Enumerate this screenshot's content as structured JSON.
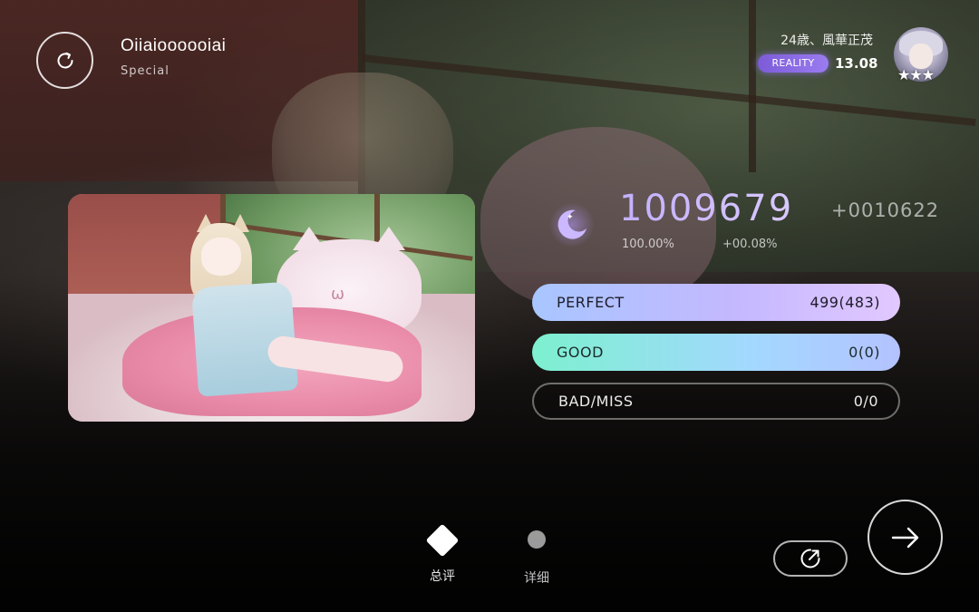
{
  "song": {
    "title": "Oiiaioooooiai",
    "difficulty": "Special"
  },
  "player": {
    "name": "24歳、風華正茂",
    "badge": "REALITY",
    "rks": "13.08",
    "stars": "★★★"
  },
  "result": {
    "score": "1009679",
    "score_delta": "+0010622",
    "accuracy": "100.00%",
    "accuracy_delta": "+00.08%"
  },
  "judgements": {
    "perfect": {
      "label": "PERFECT",
      "value": "499(483)"
    },
    "good": {
      "label": "GOOD",
      "value": "0(0)"
    },
    "bad_miss": {
      "label": "BAD/MISS",
      "value": "0/0"
    }
  },
  "nav": {
    "summary_label": "总评",
    "detail_label": "详细"
  },
  "icons": {
    "retry": "retry-icon",
    "moon": "moon-icon",
    "share": "share-icon",
    "next": "arrow-right-icon"
  },
  "colors": {
    "score_accent": "#c3b0ff",
    "badge": "#8b6be4",
    "perfect_bar": "#c4b8ff",
    "good_bar": "#7df0cf"
  }
}
